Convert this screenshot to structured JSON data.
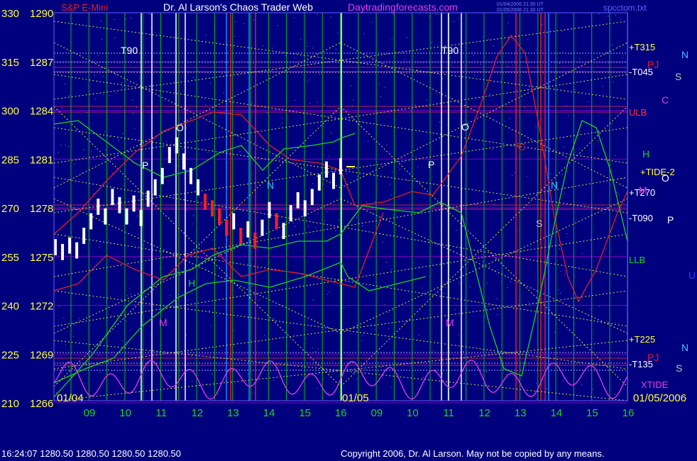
{
  "header": {
    "instrument": "S&P E-Mini",
    "title": "Dr. Al Larson's Chaos Trader Web",
    "site": "Daytradingforecasts.com",
    "timestamp_line1": "01/04/2006 21:30 UT",
    "timestamp_line2": "01/05/2006 21:30 UT",
    "filename": "spcctom.txt"
  },
  "footer": {
    "quote": "16:24:07  1280.50  1280.50  1280.50  1280.50",
    "copyright": "Copyright 2006, Dr. Al Larson. May not be copied by any means."
  },
  "colors": {
    "background": "#00007f",
    "frame": "#6060ff",
    "grid_vertical": "#00d000",
    "grid_horizontal": "#8000c0",
    "yellow_lines": "#ffff40",
    "price_bars": "#ffffff",
    "down_bars": "#ff2020",
    "red_curve": "#e02020",
    "green_curve": "#20d020",
    "tide_curve": "#e040e0"
  },
  "chart_data": {
    "type": "line",
    "ylim": [
      1266,
      1290
    ],
    "y_ticks": [
      {
        "left": "330",
        "price": "1290"
      },
      {
        "left": "315",
        "price": "1287"
      },
      {
        "left": "300",
        "price": "1284"
      },
      {
        "left": "285",
        "price": "1281"
      },
      {
        "left": "270",
        "price": "1278"
      },
      {
        "left": "255",
        "price": "1275"
      },
      {
        "left": "240",
        "price": "1272"
      },
      {
        "left": "225",
        "price": "1269"
      },
      {
        "left": "210",
        "price": "1266"
      }
    ],
    "x_ticks": [
      "09",
      "10",
      "11",
      "12",
      "13",
      "14",
      "15",
      "16",
      "09",
      "10",
      "11",
      "12",
      "13",
      "14",
      "15",
      "16"
    ],
    "date_labels": [
      "01/04",
      "01/05",
      "01/05/2006"
    ],
    "right_labels": [
      {
        "text": "+T315",
        "color": "#ffff40"
      },
      {
        "text": "-T045",
        "color": "#ffffff"
      },
      {
        "text": "ULB",
        "color": "#ff3030"
      },
      {
        "text": "+TIDE-2",
        "color": "#ffff40"
      },
      {
        "text": "+T270",
        "color": "#ffffff"
      },
      {
        "text": "-T090",
        "color": "#ffffff"
      },
      {
        "text": "LLB",
        "color": "#20d020"
      },
      {
        "text": "+T225",
        "color": "#ffff40"
      },
      {
        "text": "-T135",
        "color": "#ffffff"
      },
      {
        "text": "XTIDE",
        "color": "#e040e0"
      }
    ],
    "planet_labels": [
      {
        "text": "N",
        "color": "#40c0ff"
      },
      {
        "text": "PJ",
        "color": "#e02020"
      },
      {
        "text": "S",
        "color": "#c0c0c0"
      },
      {
        "text": "C",
        "color": "#e040e0"
      },
      {
        "text": "H",
        "color": "#20d020"
      },
      {
        "text": "O",
        "color": "#ffffff"
      },
      {
        "text": "M",
        "color": "#e040e0"
      },
      {
        "text": "P",
        "color": "#ffffff"
      },
      {
        "text": "U",
        "color": "#2040ff"
      },
      {
        "text": "N",
        "color": "#40c0ff"
      },
      {
        "text": "PJ",
        "color": "#e02020"
      },
      {
        "text": "S",
        "color": "#c0c0c0"
      }
    ],
    "chart_markers": [
      "T90",
      "T90",
      "O",
      "O",
      "P",
      "P",
      "H",
      "M",
      "M",
      "N",
      "N",
      "S",
      "C"
    ],
    "price_series": [
      1275.5,
      1275.2,
      1275.6,
      1275.3,
      1276.2,
      1277.1,
      1278.0,
      1277.4,
      1278.6,
      1278.1,
      1277.4,
      1278.2,
      1277.3,
      1278.5,
      1279.2,
      1279.9,
      1281.2,
      1281.8,
      1280.8,
      1279.9,
      1279.2,
      1278.3,
      1277.9,
      1277.4,
      1276.7,
      1277.1,
      1276.2,
      1276.6,
      1275.9,
      1276.7,
      1277.8,
      1277.1,
      1276.5,
      1277.6,
      1278.4,
      1277.9,
      1278.6,
      1279.5,
      1280.3,
      1279.6,
      1280.5
    ]
  }
}
